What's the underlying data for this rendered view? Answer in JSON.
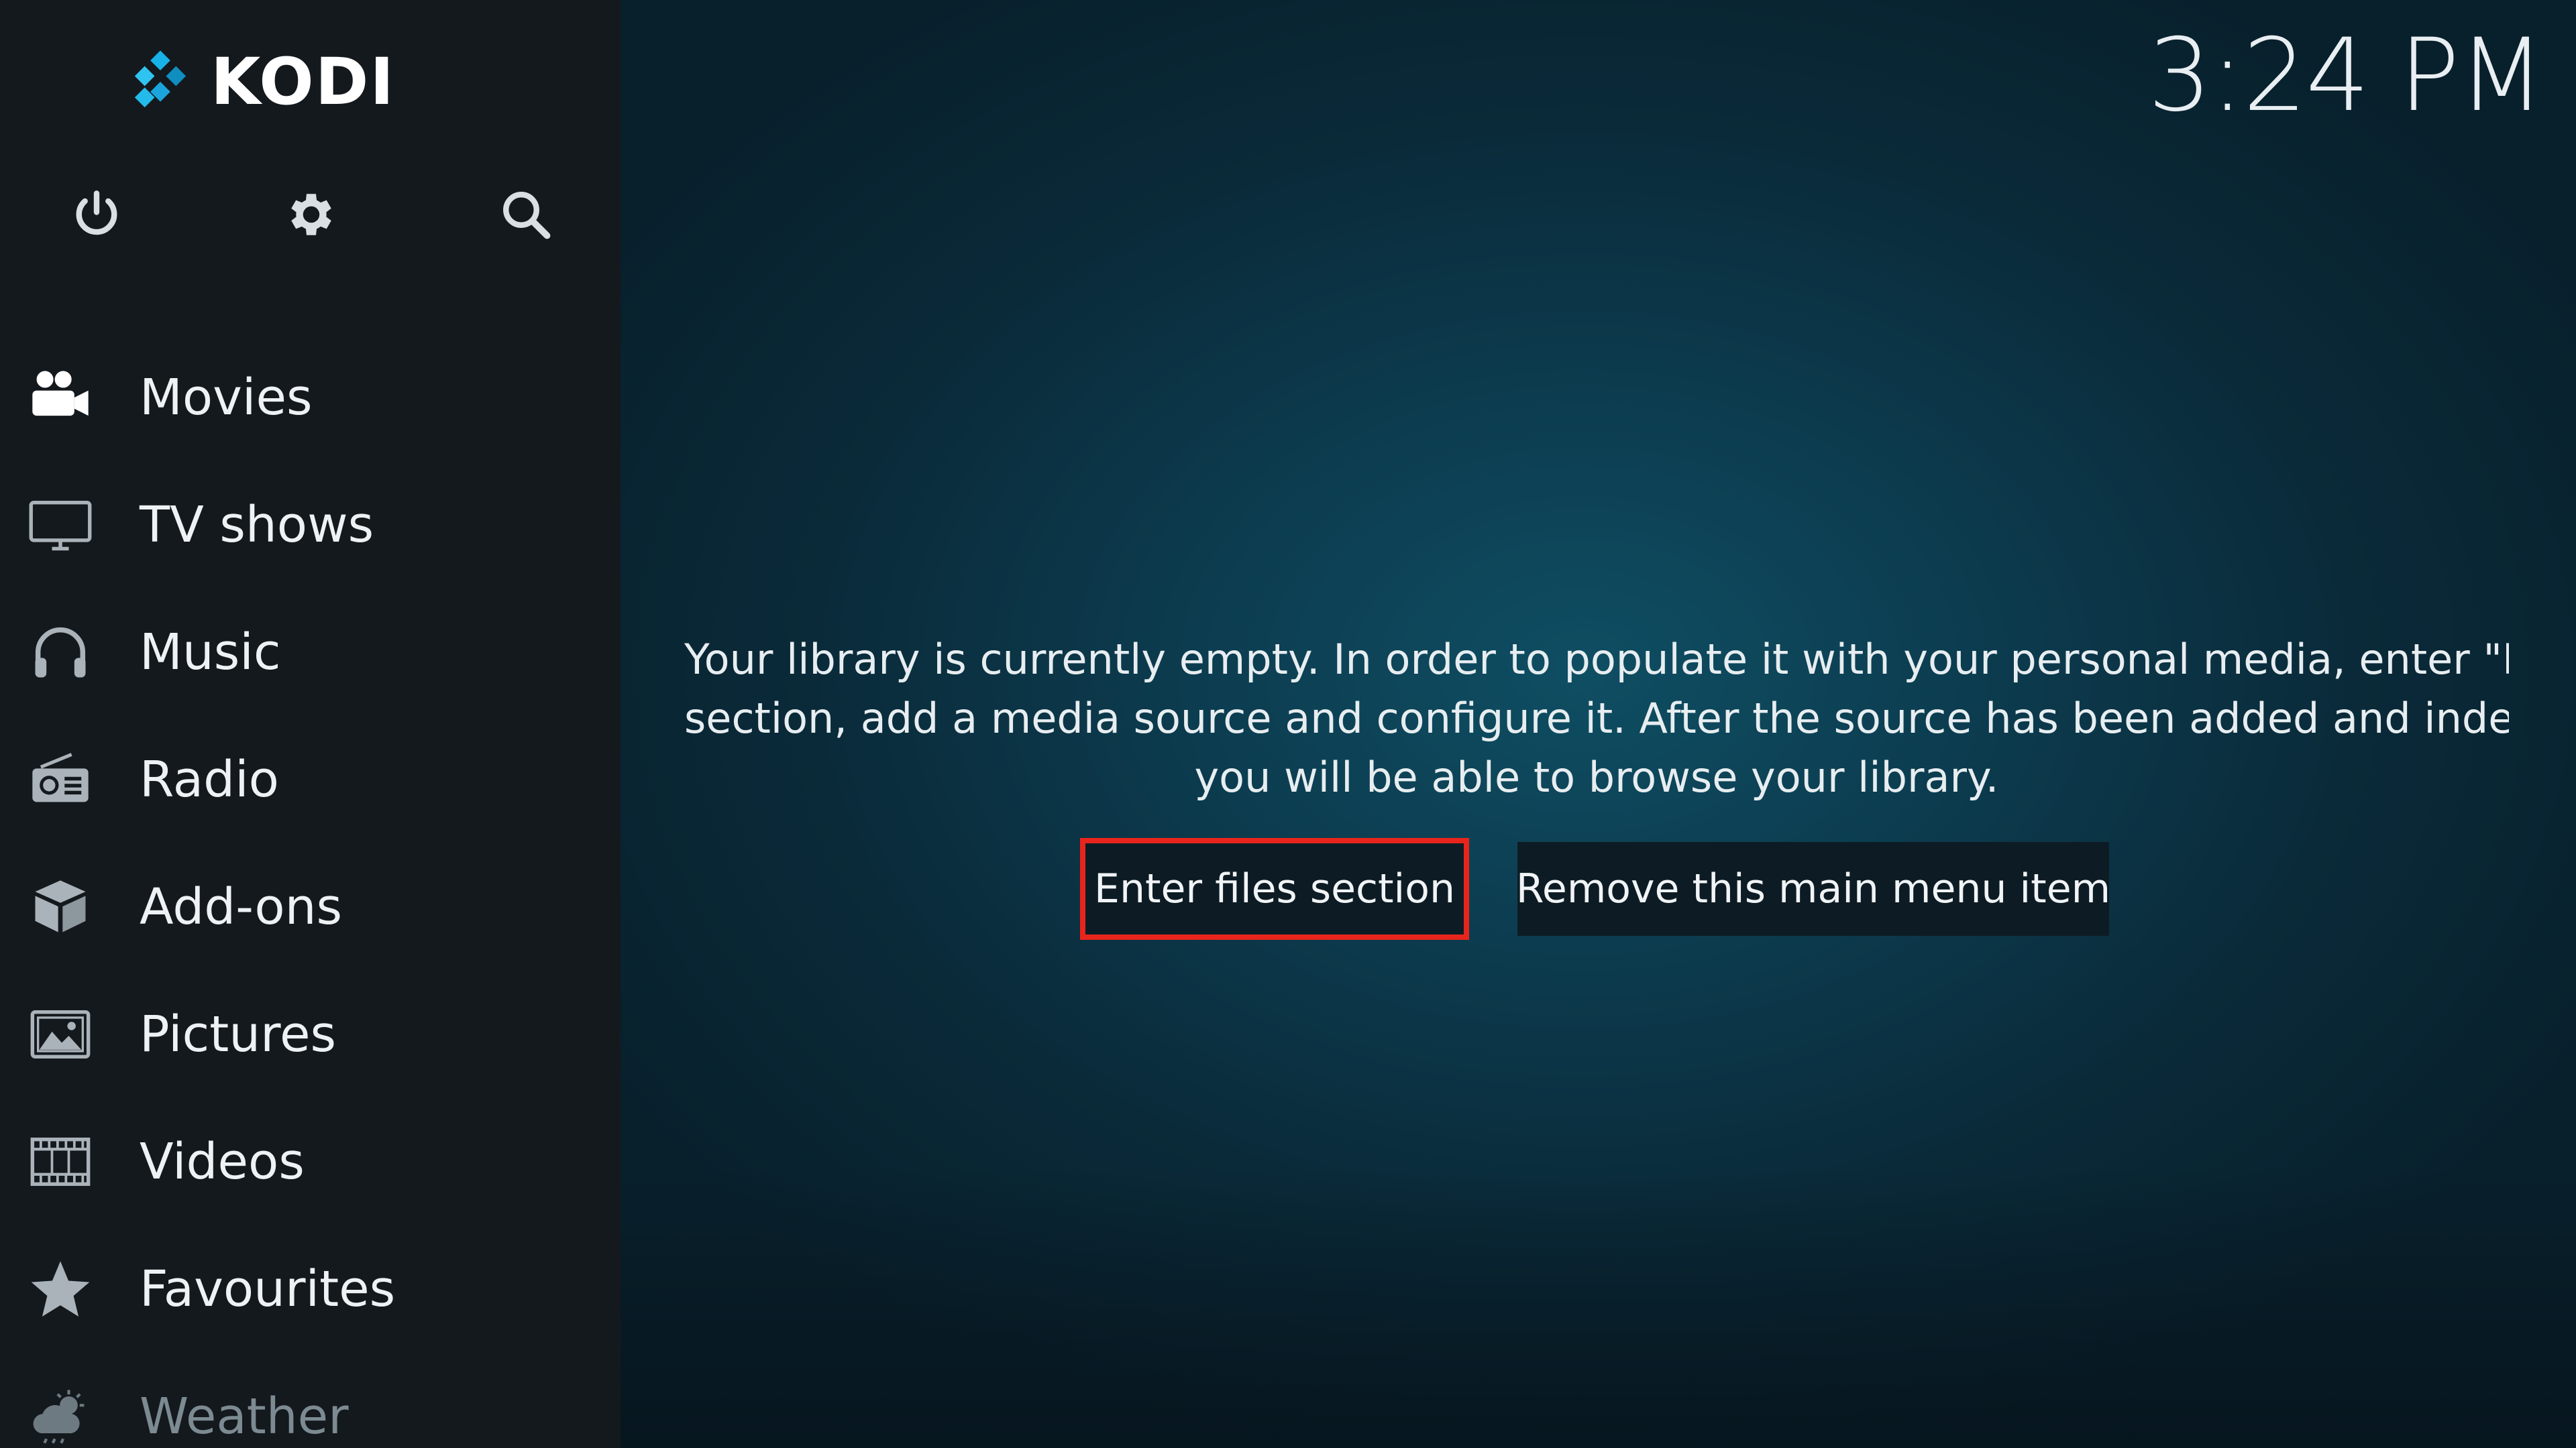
{
  "app": {
    "logo_text": "KODI",
    "clock": "3:24 PM"
  },
  "top_icons": [
    {
      "name": "power-icon"
    },
    {
      "name": "gear-icon"
    },
    {
      "name": "search-icon"
    }
  ],
  "menu": {
    "items": [
      {
        "label": "Movies",
        "icon": "movie-camera-icon"
      },
      {
        "label": "TV shows",
        "icon": "tv-icon"
      },
      {
        "label": "Music",
        "icon": "headphones-icon"
      },
      {
        "label": "Radio",
        "icon": "radio-icon"
      },
      {
        "label": "Add-ons",
        "icon": "addons-box-icon"
      },
      {
        "label": "Pictures",
        "icon": "picture-icon"
      },
      {
        "label": "Videos",
        "icon": "film-strip-icon"
      },
      {
        "label": "Favourites",
        "icon": "star-icon"
      },
      {
        "label": "Weather",
        "icon": "weather-cloud-icon"
      }
    ]
  },
  "main": {
    "message_lines": [
      "Your library is currently empty. In order to populate it with your personal media, enter \"Files\"",
      "section, add a media source and configure it. After the source has been added and indexed",
      "you will be able to browse your library."
    ],
    "buttons": {
      "enter_files": "Enter files section",
      "remove_item": "Remove this main menu item"
    }
  },
  "colors": {
    "sidebar_bg": "#14191e",
    "focus_border": "#e8251c",
    "logo_blue": "#17b2e7"
  }
}
